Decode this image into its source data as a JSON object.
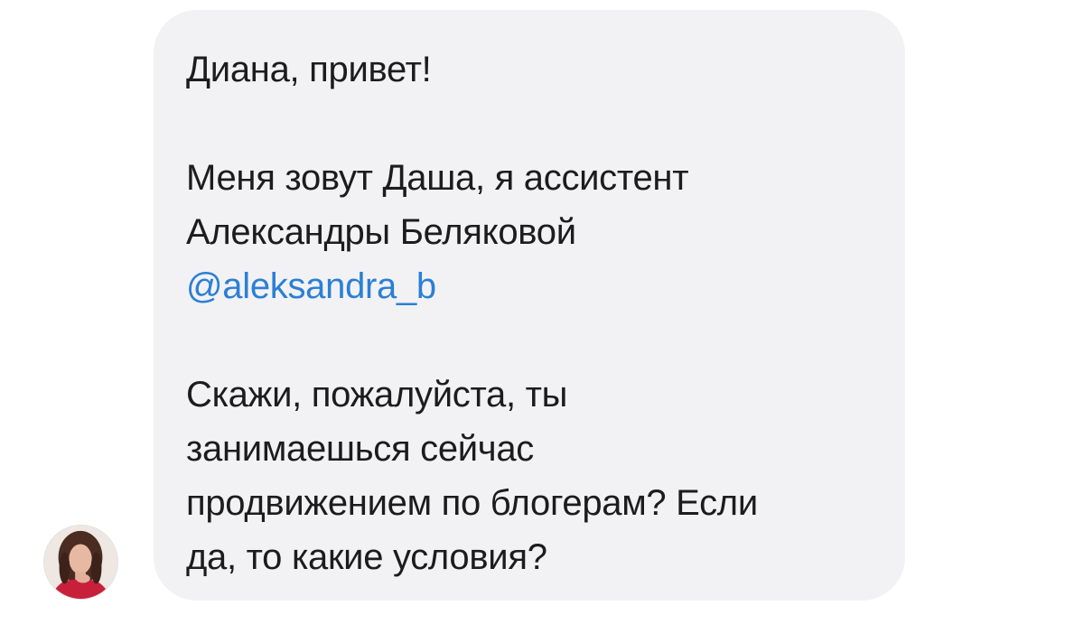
{
  "sender": {
    "avatar_icon": "profile-photo"
  },
  "message": {
    "greeting": "Диана, привет!",
    "intro_line1": "Меня зовут Даша, я ассистент",
    "intro_line2": "Александры Беляковой",
    "mention": "@aleksandra_b",
    "question_line1": "Скажи, пожалуйста, ты",
    "question_line2": "занимаешься сейчас",
    "question_line3": "продвижением по блогерам? Если",
    "question_line4": "да, то какие условия?"
  },
  "colors": {
    "bubble_background": "#f2f2f4",
    "text": "#1c1c1e",
    "mention_link": "#2b7fd6"
  }
}
